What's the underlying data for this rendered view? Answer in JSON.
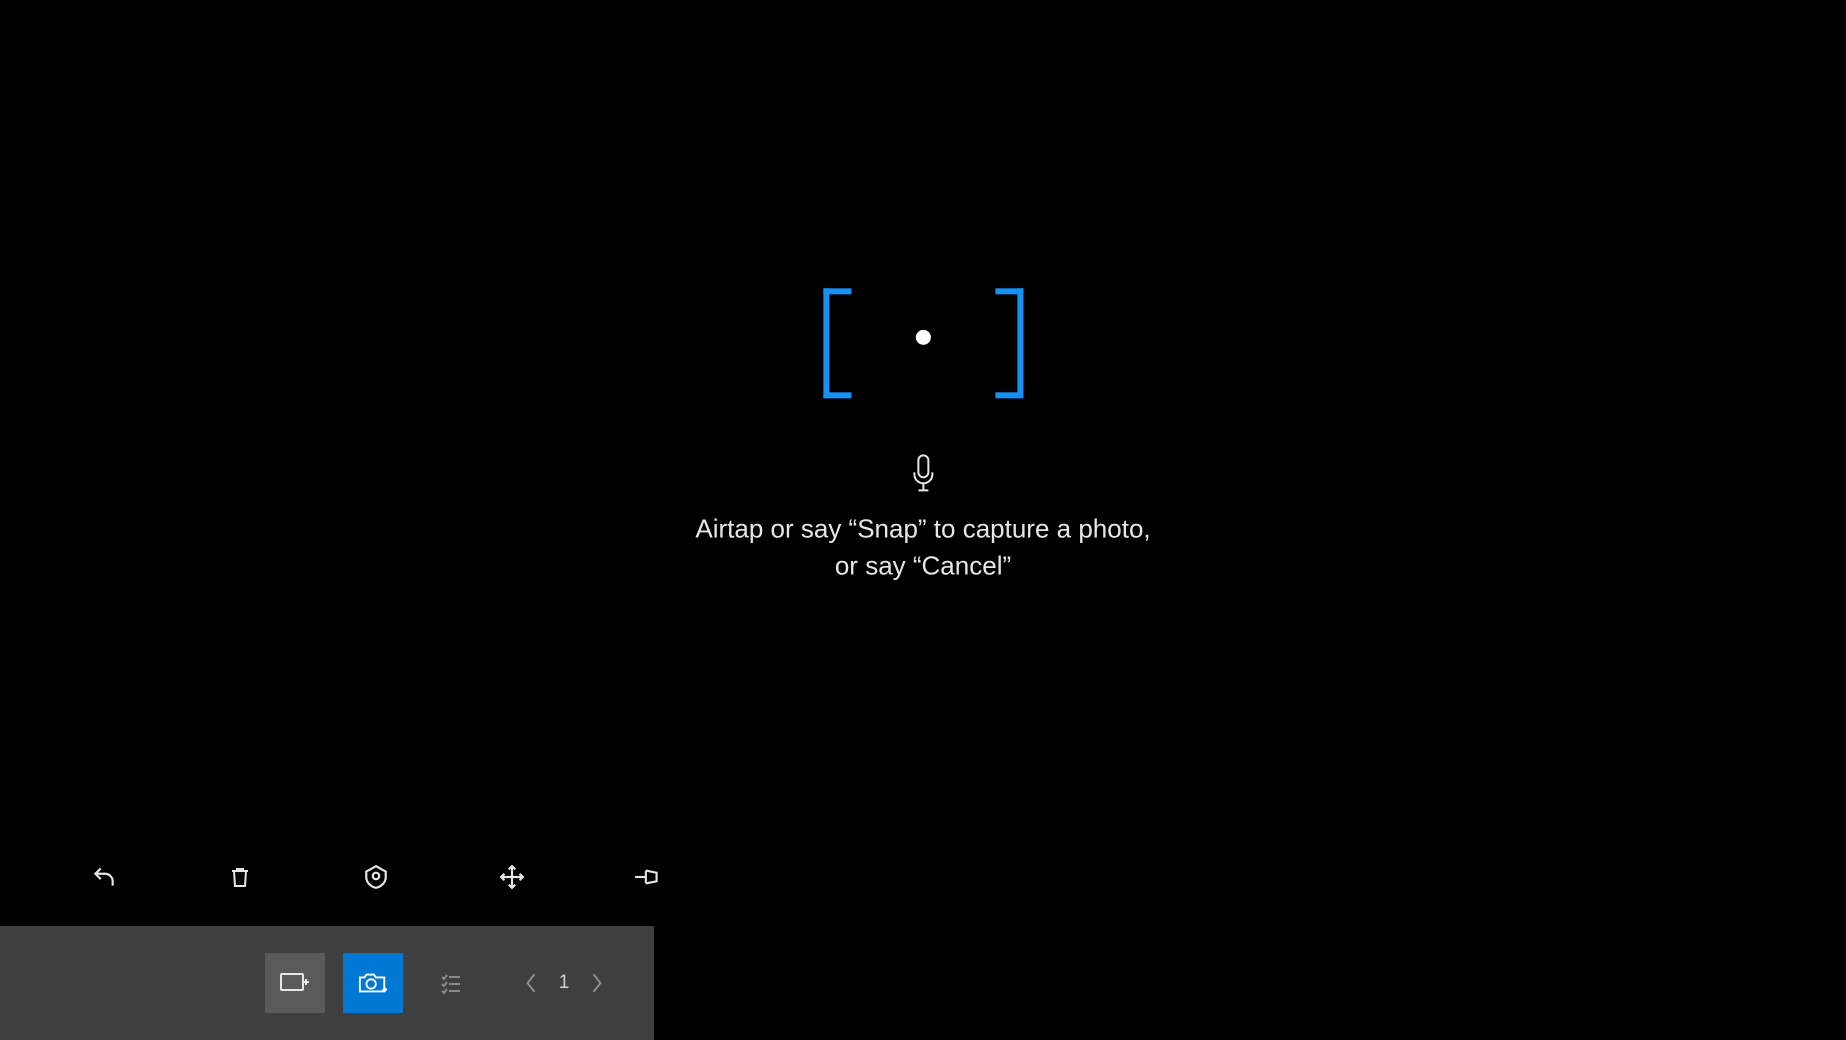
{
  "camera": {
    "instructions_line1": "Airtap or say “Snap” to capture a photo,",
    "instructions_line2": "or say “Cancel”"
  },
  "icons": {
    "microphone": "microphone-icon",
    "undo": "undo-icon",
    "trash": "trash-icon",
    "locate": "locate-icon",
    "move": "move-icon",
    "pin": "pin-icon",
    "annotate": "annotate-icon",
    "camera": "camera-icon",
    "list": "list-icon",
    "prev": "chevron-left-icon",
    "next": "chevron-right-icon"
  },
  "toolbar": {
    "undo_label": "Undo",
    "trash_label": "Delete",
    "locate_label": "Locate",
    "move_label": "Move",
    "pin_label": "Pin"
  },
  "bottom_bar": {
    "annotate_label": "Annotate",
    "camera_label": "Camera",
    "list_label": "List",
    "page": "1"
  },
  "colors": {
    "accent": "#0078d4",
    "bracket": "#1890f0",
    "bar_bg": "#3f3f3f"
  }
}
